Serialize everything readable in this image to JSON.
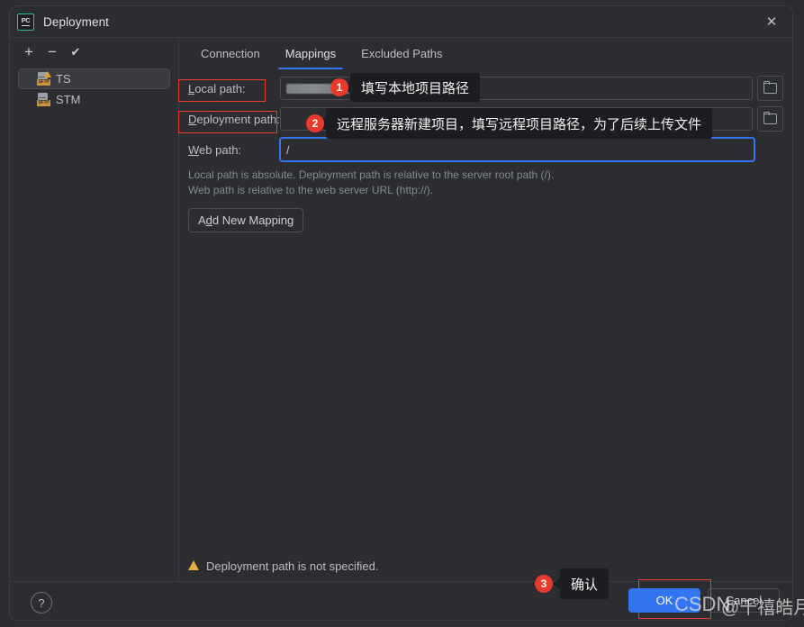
{
  "window": {
    "title": "Deployment",
    "app_icon": "pycharm-icon",
    "app_icon_text": "PC",
    "close_icon": "close-icon",
    "accent_color": "#3574f0",
    "annotation_color": "#e8392c"
  },
  "sidebar": {
    "toolbar": [
      {
        "name": "add-server-button",
        "icon": "plus-icon",
        "glyph": "+"
      },
      {
        "name": "remove-server-button",
        "icon": "minus-icon",
        "glyph": "−"
      },
      {
        "name": "set-default-button",
        "icon": "check-icon",
        "glyph": "✔"
      }
    ],
    "items": [
      {
        "label": "TS",
        "icon": "sftp-server-warning-icon",
        "icon_label": "SFTP",
        "selected": true,
        "has_warning": true
      },
      {
        "label": "STM",
        "icon": "sftp-server-icon",
        "icon_label": "SFTP",
        "selected": false,
        "has_warning": false
      }
    ]
  },
  "tabs": [
    {
      "label": "Connection",
      "active": false
    },
    {
      "label": "Mappings",
      "active": true
    },
    {
      "label": "Excluded Paths",
      "active": false
    }
  ],
  "form": {
    "local_path": {
      "label": "Local path:",
      "mnemonic": "L",
      "rest": "ocal path:",
      "value": "",
      "redacted": true,
      "browse_icon": "folder-icon"
    },
    "deployment_path": {
      "label": "Deployment path:",
      "mnemonic": "D",
      "rest": "eployment path:",
      "value": "",
      "browse_icon": "folder-icon"
    },
    "web_path": {
      "label": "Web path:",
      "mnemonic": "W",
      "rest": "eb path:",
      "value": "/",
      "focused": true
    },
    "hints": [
      "Local path is absolute. Deployment path is relative to the server root path (/).",
      "Web path is relative to the web server URL (http://)."
    ],
    "add_mapping": {
      "label": "Add New Mapping",
      "mnemonic_prefix": "A",
      "mnemonic_char": "d",
      "mnemonic_rest": "d New Mapping"
    }
  },
  "status": {
    "warning_icon": "warning-triangle-icon",
    "message": "Deployment path is not specified."
  },
  "footer": {
    "help_icon": "help-icon",
    "help_glyph": "?",
    "ok_label": "OK",
    "cancel_label": "Cancel"
  },
  "annotations": [
    {
      "badge": "1",
      "text": "填写本地项目路径"
    },
    {
      "badge": "2",
      "text": "远程服务器新建项目，填写远程项目路径，为了后续上传文件"
    },
    {
      "badge": "3",
      "text": "确认"
    }
  ],
  "watermark": {
    "brand": "CSDN",
    "author": "@千禧皓月"
  }
}
